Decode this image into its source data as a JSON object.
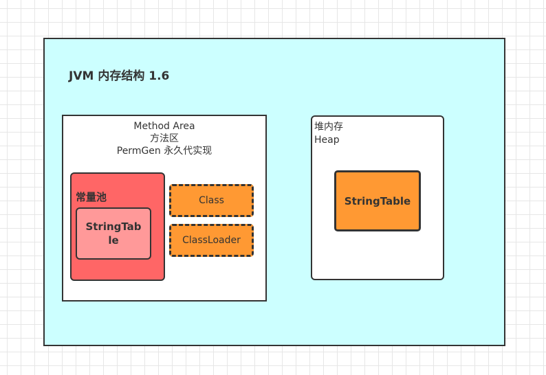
{
  "diagram": {
    "title": "JVM 内存结构 1.6",
    "method_area": {
      "line1": "Method Area",
      "line2": "方法区",
      "line3": "PermGen 永久代实现",
      "constant_pool": {
        "label": "常量池",
        "string_table": "StringTable"
      },
      "class_box": "Class",
      "classloader_box": "ClassLoader"
    },
    "heap": {
      "line1": "堆内存",
      "line2": "Heap",
      "string_table": "StringTable"
    }
  },
  "colors": {
    "outer_fill": "#ccffff",
    "pool_fill": "#ff6666",
    "string_table_pool_fill": "#ff9999",
    "orange_fill": "#ff9933",
    "stroke": "#333333"
  }
}
